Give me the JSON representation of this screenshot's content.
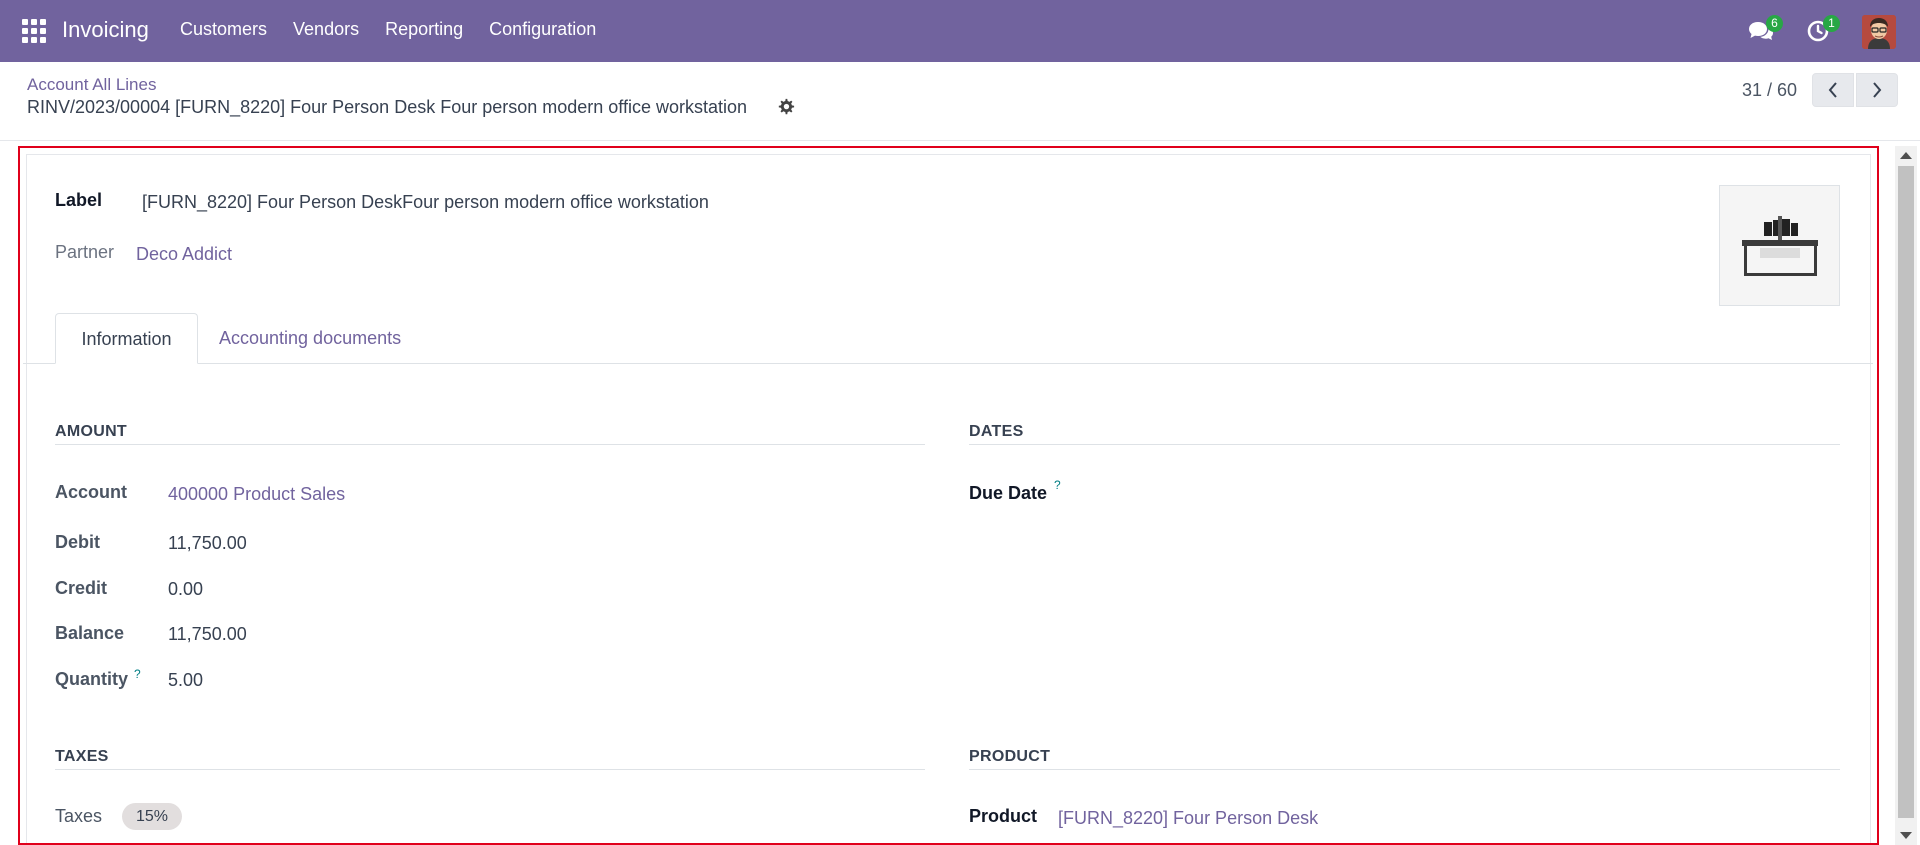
{
  "navbar": {
    "app_name": "Invoicing",
    "menu": [
      "Customers",
      "Vendors",
      "Reporting",
      "Configuration"
    ],
    "messages_count": "6",
    "activities_count": "1",
    "bg_color": "#71639e"
  },
  "control_panel": {
    "breadcrumb_parent": "Account All Lines",
    "record_title": "RINV/2023/00004 [FURN_8220] Four Person Desk Four person modern office workstation",
    "pager": "31 / 60"
  },
  "form": {
    "label_label": "Label",
    "label_value": "[FURN_8220] Four Person DeskFour person modern office workstation",
    "partner_label": "Partner",
    "partner_value": "Deco Addict",
    "tabs": [
      "Information",
      "Accounting documents"
    ],
    "amount": {
      "title": "AMOUNT",
      "account_label": "Account",
      "account_value": "400000 Product Sales",
      "debit_label": "Debit",
      "debit_value": "11,750.00",
      "credit_label": "Credit",
      "credit_value": "0.00",
      "balance_label": "Balance",
      "balance_value": "11,750.00",
      "quantity_label": "Quantity",
      "quantity_help": "?",
      "quantity_value": "5.00"
    },
    "dates": {
      "title": "DATES",
      "due_date_label": "Due Date",
      "due_date_help": "?"
    },
    "taxes": {
      "title": "TAXES",
      "taxes_label": "Taxes",
      "tax_tag": "15%"
    },
    "product": {
      "title": "PRODUCT",
      "product_label": "Product",
      "product_value": "[FURN_8220] Four Person Desk"
    }
  },
  "colors": {
    "accent": "#71639e",
    "highlight_border": "#e0001b",
    "badge": "#28a745"
  }
}
